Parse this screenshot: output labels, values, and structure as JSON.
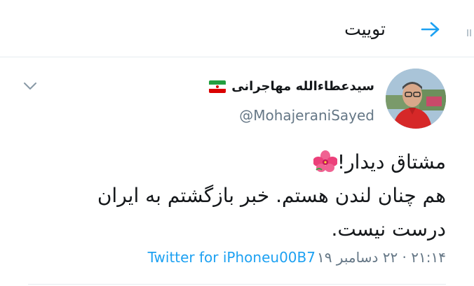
{
  "header": {
    "title": "توییت",
    "back_icon": "arrow-right-icon",
    "accent_color": "#1da1f2"
  },
  "tweet": {
    "display_name": "سیدعطاءالله مهاجرانی",
    "flag_icon": "iran-flag-icon",
    "handle": "@MohajeraniSayed",
    "menu_icon": "chevron-down-icon",
    "body_lines": [
      "مشتاق دیدار!",
      "هم چنان لندن هستم. خبر بازگشتم به ایران",
      "درست نیست."
    ],
    "emoji_icon": "hibiscus-flower-icon",
    "timestamp": "۲۱:۱۴ · ۲۲ دسامبر ۱۹",
    "source": "Twitter for iPhone",
    "separator": " u00B7 ",
    "link_color": "#1da1f2",
    "muted_color": "#657786"
  }
}
